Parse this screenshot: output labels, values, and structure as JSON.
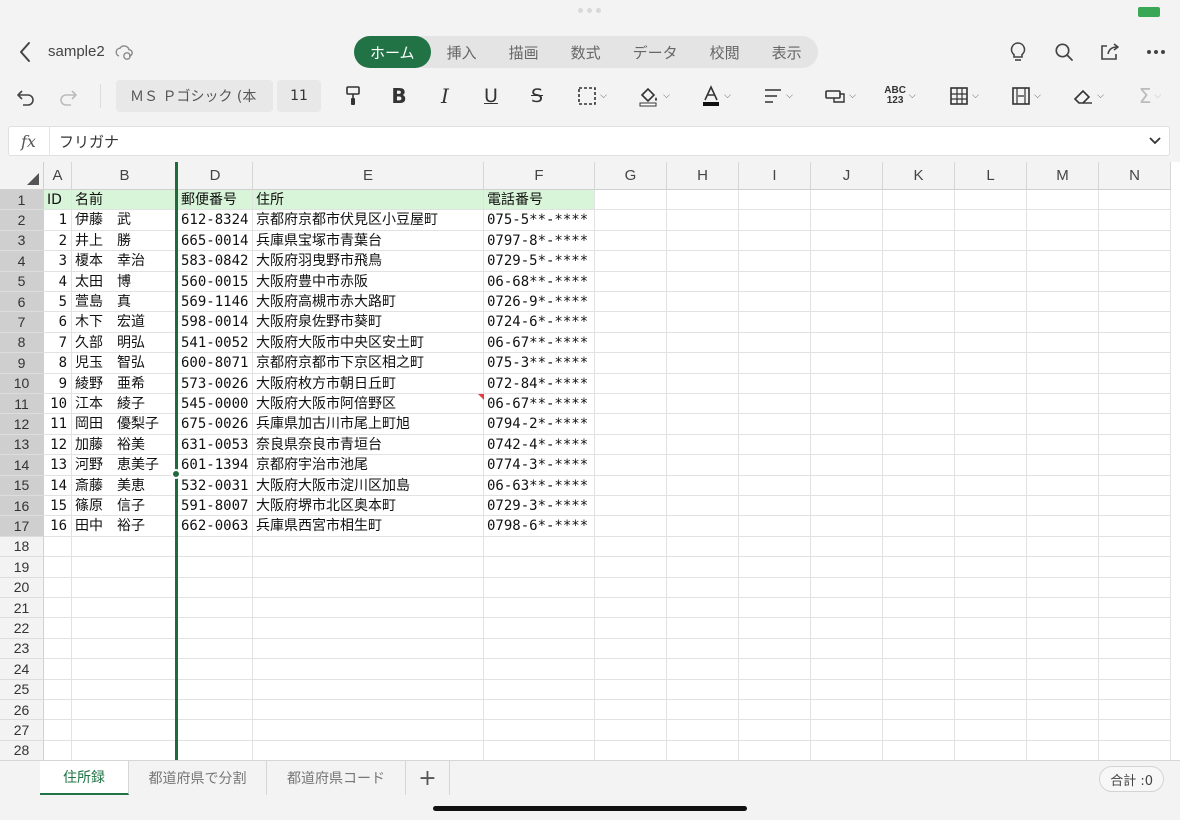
{
  "header": {
    "title": "sample2",
    "tabs": [
      {
        "label": "ホーム",
        "active": true
      },
      {
        "label": "挿入"
      },
      {
        "label": "描画"
      },
      {
        "label": "数式"
      },
      {
        "label": "データ"
      },
      {
        "label": "校閲"
      },
      {
        "label": "表示"
      }
    ],
    "icons": [
      "lightbulb-icon",
      "search-icon",
      "share-icon",
      "more-icon"
    ]
  },
  "toolbar": {
    "font_name": "ＭＳ Ｐゴシック (本",
    "font_size": "11"
  },
  "formula_bar": {
    "fx_label": "fx",
    "value": "フリガナ"
  },
  "grid": {
    "columns": [
      "A",
      "B",
      "D",
      "E",
      "F",
      "G",
      "H",
      "I",
      "J",
      "K",
      "L",
      "M",
      "N"
    ],
    "row_numbers": [
      "1",
      "2",
      "3",
      "4",
      "5",
      "6",
      "7",
      "8",
      "9",
      "10",
      "11",
      "12",
      "13",
      "14",
      "15",
      "16",
      "17",
      "18",
      "19",
      "20",
      "21",
      "22",
      "23",
      "24",
      "25",
      "26",
      "27",
      "28"
    ],
    "header_row": [
      "ID",
      "名前",
      "郵便番号",
      "住所",
      "電話番号"
    ],
    "rows": [
      [
        "1",
        "伊藤　武",
        "612-8324",
        "京都府京都市伏見区小豆屋町",
        "075-5**-****"
      ],
      [
        "2",
        "井上　勝",
        "665-0014",
        "兵庫県宝塚市青葉台",
        "0797-8*-****"
      ],
      [
        "3",
        "榎本　幸治",
        "583-0842",
        "大阪府羽曳野市飛鳥",
        "0729-5*-****"
      ],
      [
        "4",
        "太田　博",
        "560-0015",
        "大阪府豊中市赤阪",
        "06-68**-****"
      ],
      [
        "5",
        "萱島　真",
        "569-1146",
        "大阪府高槻市赤大路町",
        "0726-9*-****"
      ],
      [
        "6",
        "木下　宏道",
        "598-0014",
        "大阪府泉佐野市葵町",
        "0724-6*-****"
      ],
      [
        "7",
        "久部　明弘",
        "541-0052",
        "大阪府大阪市中央区安土町",
        "06-67**-****"
      ],
      [
        "8",
        "児玉　智弘",
        "600-8071",
        "京都府京都市下京区相之町",
        "075-3**-****"
      ],
      [
        "9",
        "綾野　亜希",
        "573-0026",
        "大阪府枚方市朝日丘町",
        "072-84*-****"
      ],
      [
        "10",
        "江本　綾子",
        "545-0000",
        "大阪府大阪市阿倍野区",
        "06-67**-****"
      ],
      [
        "11",
        "岡田　優梨子",
        "675-0026",
        "兵庫県加古川市尾上町旭",
        "0794-2*-****"
      ],
      [
        "12",
        "加藤　裕美",
        "631-0053",
        "奈良県奈良市青垣台",
        "0742-4*-****"
      ],
      [
        "13",
        "河野　恵美子",
        "601-1394",
        "京都府宇治市池尾",
        "0774-3*-****"
      ],
      [
        "14",
        "斎藤　美恵",
        "532-0031",
        "大阪府大阪市淀川区加島",
        "06-63**-****"
      ],
      [
        "15",
        "篠原　信子",
        "591-8007",
        "大阪府堺市北区奥本町",
        "0729-3*-****"
      ],
      [
        "16",
        "田中　裕子",
        "662-0063",
        "兵庫県西宮市相生町",
        "0798-6*-****"
      ]
    ]
  },
  "sheets": {
    "tabs": [
      {
        "label": "住所録",
        "active": true
      },
      {
        "label": "都道府県で分割"
      },
      {
        "label": "都道府県コード"
      }
    ],
    "add_label": "+",
    "sum_label": "合計 :0"
  },
  "colors": {
    "accent": "#217346",
    "header_fill": "#d9f5d9",
    "comment_marker": "#e2403a"
  }
}
